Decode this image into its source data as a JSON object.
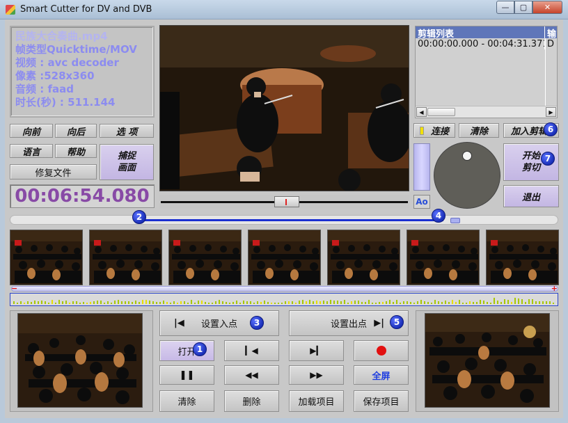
{
  "window": {
    "title": "Smart Cutter for DV and DVB",
    "minimize_glyph": "—",
    "maximize_glyph": "▢",
    "close_glyph": "✕"
  },
  "info": {
    "filename": "民族大合奏曲.mp4",
    "frame_type": "帧类型Quicktime/MOV",
    "video": "视频 : avc decoder",
    "pixels": "像素 :528x360",
    "audio": "音频 : faad",
    "duration": "时长(秒) : 511.144"
  },
  "left_buttons": {
    "forward": "向前",
    "backward": "向后",
    "options": "选 项",
    "language": "语言",
    "help": "帮助",
    "capture": "捕捉\n画面",
    "repair": "修复文件"
  },
  "timecode": "00:06:54.080",
  "edit_list": {
    "header_col1": "剪辑列表",
    "header_col2": "输",
    "rows": [
      {
        "range": "00:00:00.000 - 00:04:31.371",
        "col2": "D"
      }
    ],
    "scroll_left": "◀",
    "scroll_right": "▶"
  },
  "right_controls": {
    "link": "连接",
    "clear": "清除",
    "add_clip": "加入剪辑",
    "start_cut": "开始\n剪切",
    "exit": "退出",
    "ao_label": "Ao"
  },
  "badges": [
    "1",
    "2",
    "3",
    "4",
    "5",
    "6",
    "7"
  ],
  "transport": {
    "set_in": "设置入点",
    "set_out": "设置出点",
    "open": "打开",
    "fullscreen": "全屏",
    "clear": "清除",
    "delete": "删除",
    "load_project": "加载项目",
    "save_project": "保存项目"
  },
  "icons": {
    "set_in": "prev-marker-icon",
    "set_out": "next-marker-icon",
    "step_back": "step-back-icon",
    "step_forward": "step-forward-icon",
    "record": "record-icon",
    "pause": "pause-icon",
    "rewind": "rewind-icon",
    "fast_forward": "fast-forward-icon"
  },
  "colors": {
    "info_text": "#8c8cf0",
    "timecode": "#884aa6",
    "selection": "#1a2fd1",
    "badge": "#1a2fb8",
    "list_header": "#5f76b9"
  }
}
